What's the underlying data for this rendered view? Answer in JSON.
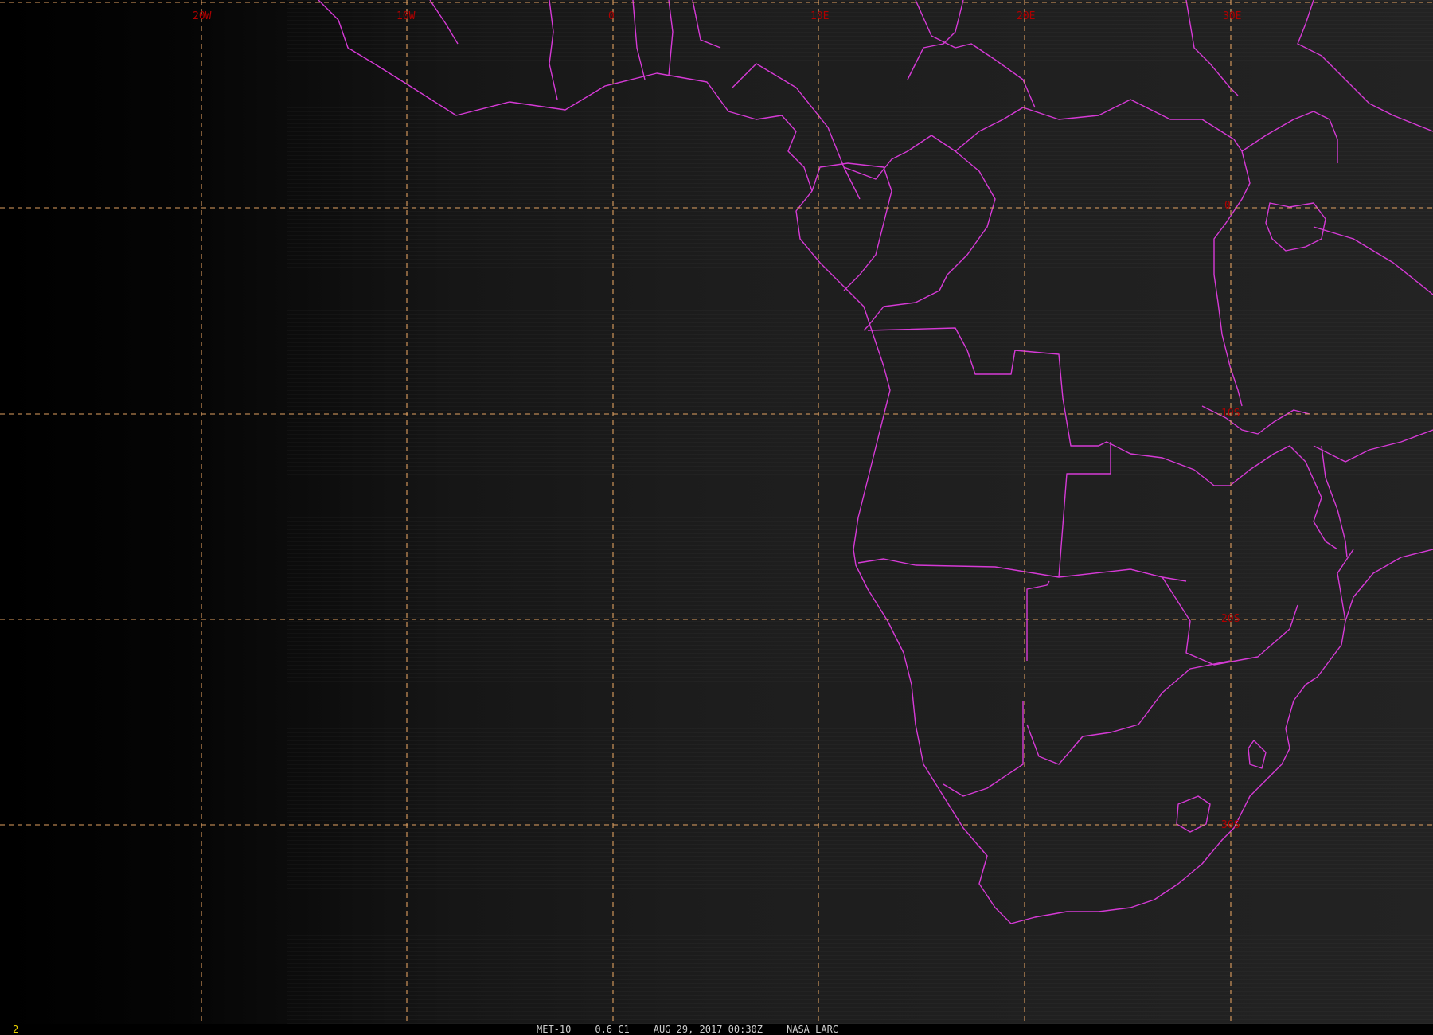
{
  "image": {
    "satellite": "MET-10",
    "channel": "0.6 C1",
    "datetime": "AUG 29, 2017 00:30Z",
    "credit": "NASA LARC",
    "frame_number": "2"
  },
  "grid": {
    "longitude_labels": [
      "20W",
      "10W",
      "0",
      "10E",
      "20E",
      "30E"
    ],
    "latitude_labels": [
      "0",
      "10S",
      "20S",
      "30S"
    ],
    "line_color": "#e0a060",
    "label_color": "#b00000"
  },
  "map_layers": {
    "borders_color": "#d63ad6",
    "background": "#1c1c1c",
    "terminator_shading": "dark west (night side) to grey east"
  }
}
